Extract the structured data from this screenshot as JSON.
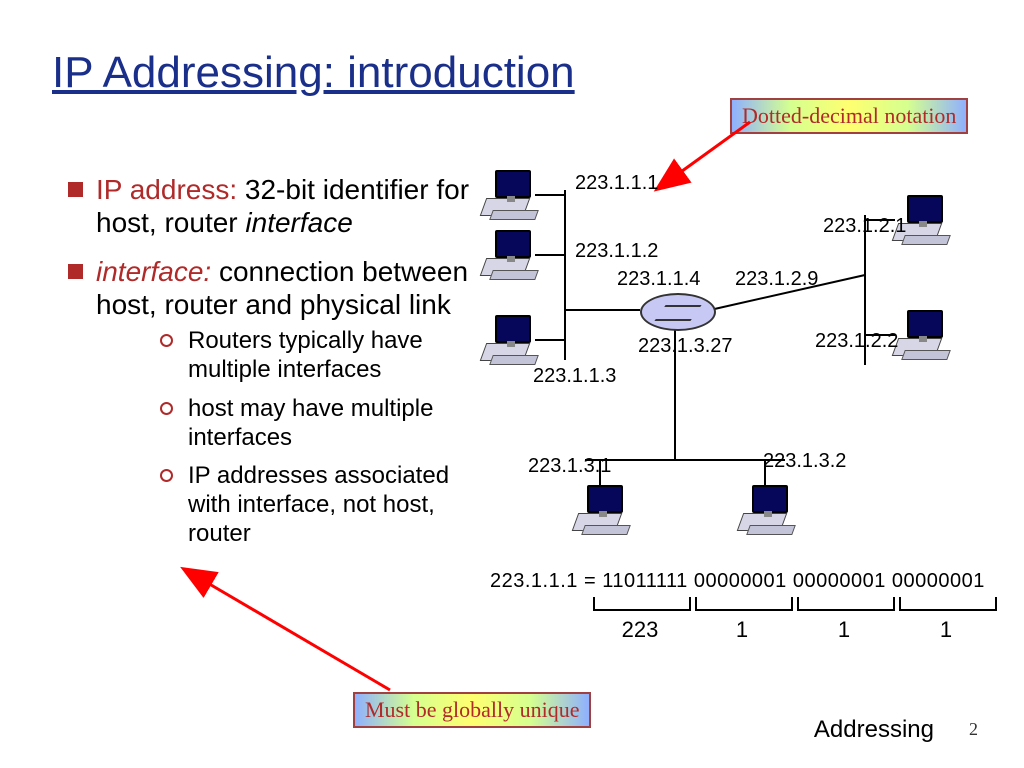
{
  "title": "IP Addressing: introduction",
  "bullets": {
    "b1_term": "IP address:",
    "b1_rest": " 32-bit identifier for host, router ",
    "b1_ital": "interface",
    "b2_term": "interface:",
    "b2_rest": " connection between host, router and physical link",
    "sub1": "Routers typically have multiple interfaces",
    "sub2": "host may have multiple interfaces",
    "sub3": "IP addresses associated with interface, not host, router"
  },
  "callouts": {
    "dotted": "Dotted-decimal notation",
    "unique": "Must be globally unique"
  },
  "ips": {
    "a1": "223.1.1.1",
    "a2": "223.1.1.2",
    "a3": "223.1.1.3",
    "a4": "223.1.1.4",
    "b1": "223.1.2.1",
    "b2": "223.1.2.2",
    "b9": "223.1.2.9",
    "c1": "223.1.3.1",
    "c2": "223.1.3.2",
    "c27": "223.1.3.27"
  },
  "binary": {
    "line": "223.1.1.1 = 11011111 00000001 00000001 00000001",
    "o1": "223",
    "o2": "1",
    "o3": "1",
    "o4": "1"
  },
  "footer": {
    "section": "Addressing",
    "page": "2"
  }
}
